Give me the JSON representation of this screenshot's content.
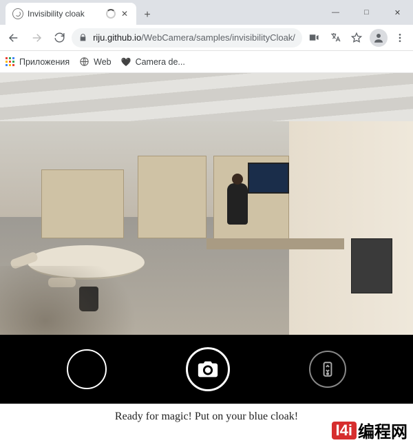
{
  "window": {
    "tab_title": "Invisibility cloak",
    "close_glyph": "✕",
    "newtab_glyph": "+",
    "min_glyph": "—",
    "max_glyph": "□",
    "winclose_glyph": "✕"
  },
  "addressbar": {
    "host": "riju.github.io",
    "path": "/WebCamera/samples/invisibilityCloak/"
  },
  "bookmarks": {
    "apps_label": "Приложения",
    "web_label": "Web",
    "camdemo_label": "Camera de..."
  },
  "page": {
    "status_text": "Ready for magic! Put on your blue cloak!"
  },
  "watermark": {
    "box": "I4i",
    "text": "编程网"
  }
}
